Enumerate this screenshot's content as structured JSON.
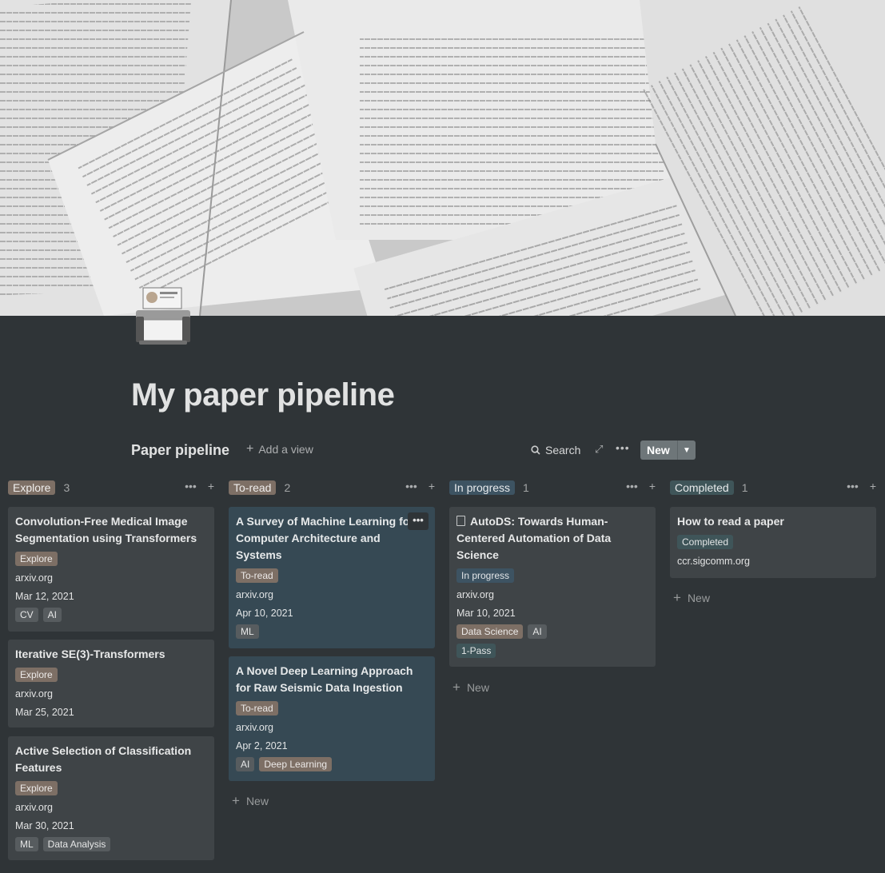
{
  "page": {
    "title": "My paper pipeline"
  },
  "view": {
    "title": "Paper pipeline",
    "add_view": "Add a view",
    "search": "Search",
    "new_button": "New"
  },
  "colors": {
    "explore": "#7d6f65",
    "toread": "#7d6f65",
    "inprogress": "#3d5362",
    "completed": "#3f5559",
    "tag_default": "#575c5f",
    "card": "#3f4447",
    "card_highlight": "#364954",
    "background": "#2f3437"
  },
  "board": {
    "columns": [
      {
        "label": "Explore",
        "count": "3",
        "cards": [
          {
            "title": "Convolution-Free Medical Image Segmentation using Transformers",
            "status": "Explore",
            "source": "arxiv.org",
            "date": "Mar 12, 2021",
            "tags": [
              "CV",
              "AI"
            ]
          },
          {
            "title": "Iterative SE(3)-Transformers",
            "status": "Explore",
            "source": "arxiv.org",
            "date": "Mar 25, 2021",
            "tags": []
          },
          {
            "title": "Active Selection of Classification Features",
            "status": "Explore",
            "source": "arxiv.org",
            "date": "Mar 30, 2021",
            "tags": [
              "ML",
              "Data Analysis"
            ]
          }
        ]
      },
      {
        "label": "To-read",
        "count": "2",
        "cards": [
          {
            "title": "A Survey of Machine Learning for Computer Architecture and Systems",
            "status": "To-read",
            "source": "arxiv.org",
            "date": "Apr 10, 2021",
            "tags": [
              "ML"
            ]
          },
          {
            "title": "A Novel Deep Learning Approach for Raw Seismic Data Ingestion",
            "status": "To-read",
            "source": "arxiv.org",
            "date": "Apr 2, 2021",
            "tags": [
              "AI",
              "Deep Learning"
            ]
          }
        ],
        "new_label": "New"
      },
      {
        "label": "In progress",
        "count": "1",
        "cards": [
          {
            "title": "AutoDS: Towards Human-Centered Automation of Data Science",
            "status": "In progress",
            "source": "arxiv.org",
            "date": "Mar 10, 2021",
            "tags": [
              "Data Science",
              "AI"
            ],
            "tags2": [
              "1-Pass"
            ]
          }
        ],
        "new_label": "New"
      },
      {
        "label": "Completed",
        "count": "1",
        "cards": [
          {
            "title": "How to read a paper",
            "status": "Completed",
            "source": "ccr.sigcomm.org"
          }
        ],
        "new_label": "New"
      }
    ]
  },
  "icons": {
    "card_more": "•••"
  }
}
